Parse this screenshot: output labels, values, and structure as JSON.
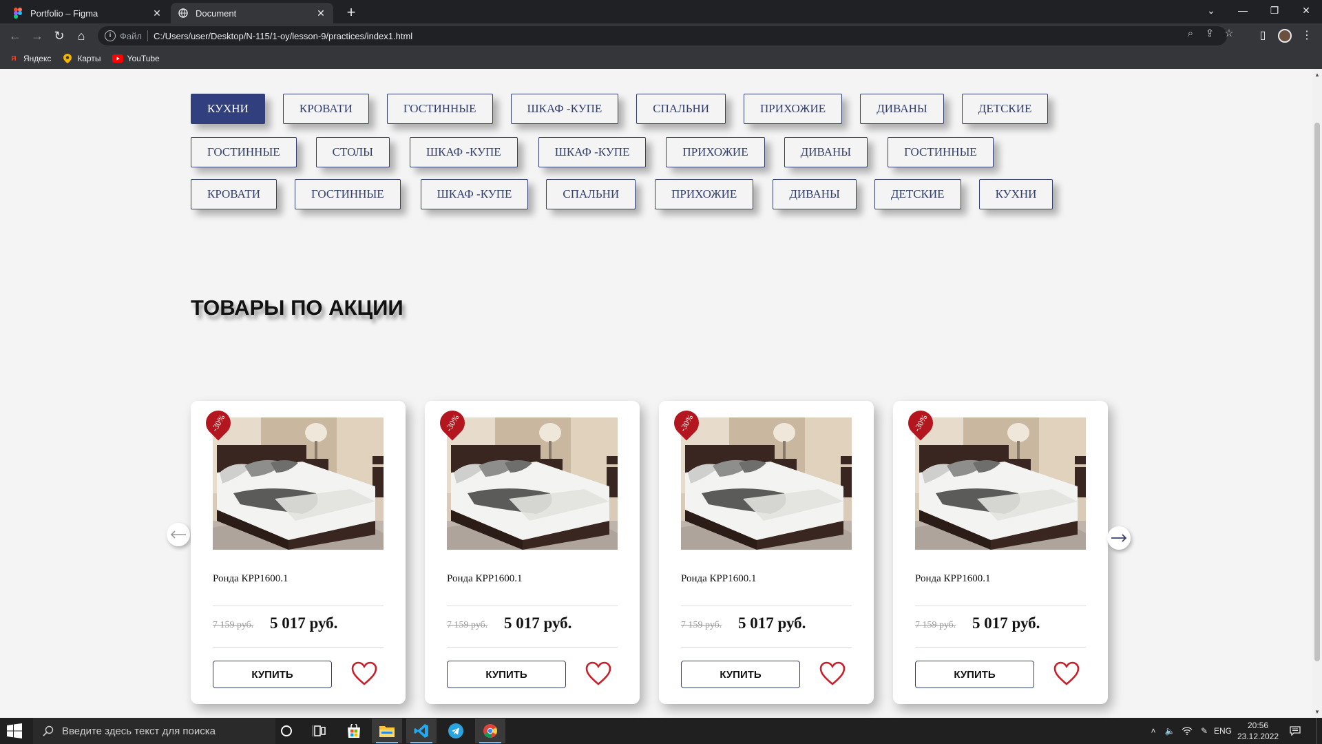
{
  "browser": {
    "tabs": [
      {
        "title": "Portfolio – Figma",
        "favicon": "figma-icon",
        "active": false
      },
      {
        "title": "Document",
        "favicon": "globe-icon",
        "active": true
      }
    ],
    "new_tab_label": "+",
    "omnibox": {
      "scheme_label": "Файл",
      "url": "C:/Users/user/Desktop/N-115/1-oy/lesson-9/practices/index1.html"
    },
    "bookmarks": [
      {
        "label": "Яндекс",
        "icon": "yandex-icon"
      },
      {
        "label": "Карты",
        "icon": "maps-pin-icon"
      },
      {
        "label": "YouTube",
        "icon": "youtube-icon"
      }
    ]
  },
  "page": {
    "categories": {
      "rows": [
        [
          {
            "label": "КУХНИ",
            "active": true
          },
          {
            "label": "КРОВАТИ"
          },
          {
            "label": "ГОСТИННЫЕ"
          },
          {
            "label": "ШКАФ -КУПЕ"
          },
          {
            "label": "СПАЛЬНИ"
          },
          {
            "label": "ПРИХОЖИЕ"
          },
          {
            "label": "ДИВАНЫ"
          },
          {
            "label": "ДЕТСКИЕ"
          }
        ],
        [
          {
            "label": "ГОСТИННЫЕ"
          },
          {
            "label": "СТОЛЫ"
          },
          {
            "label": "ШКАФ -КУПЕ"
          },
          {
            "label": "ШКАФ -КУПЕ"
          },
          {
            "label": "ПРИХОЖИЕ"
          },
          {
            "label": "ДИВАНЫ"
          },
          {
            "label": "ГОСТИННЫЕ"
          }
        ],
        [
          {
            "label": "КРОВАТИ"
          },
          {
            "label": "ГОСТИННЫЕ"
          },
          {
            "label": "ШКАФ -КУПЕ"
          },
          {
            "label": "СПАЛЬНИ"
          },
          {
            "label": "ПРИХОЖИЕ"
          },
          {
            "label": "ДИВАНЫ"
          },
          {
            "label": "ДЕТСКИЕ"
          },
          {
            "label": "КУХНИ"
          }
        ]
      ]
    },
    "promo": {
      "title": "ТОВАРЫ ПО АКЦИИ",
      "products": [
        {
          "discount": "-30%",
          "name": "Ронда КРР1600.1",
          "old_price": "7 159 руб.",
          "price": "5 017 руб.",
          "buy_label": "КУПИТЬ"
        },
        {
          "discount": "-30%",
          "name": "Ронда КРР1600.1",
          "old_price": "7 159 руб.",
          "price": "5 017 руб.",
          "buy_label": "КУПИТЬ"
        },
        {
          "discount": "-30%",
          "name": "Ронда КРР1600.1",
          "old_price": "7 159 руб.",
          "price": "5 017 руб.",
          "buy_label": "КУПИТЬ"
        },
        {
          "discount": "-30%",
          "name": "Ронда КРР1600.1",
          "old_price": "7 159 руб.",
          "price": "5 017 руб.",
          "buy_label": "КУПИТЬ"
        }
      ]
    },
    "colors": {
      "accent": "#323f7e",
      "badge": "#b3161e",
      "heart": "#c8202b"
    }
  },
  "taskbar": {
    "search_placeholder": "Введите здесь текст для поиска",
    "apps": [
      "cortana-icon",
      "task-view-icon",
      "store-icon",
      "file-explorer-icon",
      "vscode-icon",
      "telegram-icon",
      "chrome-icon"
    ],
    "language": "ENG",
    "time": "20:56",
    "date": "23.12.2022"
  }
}
